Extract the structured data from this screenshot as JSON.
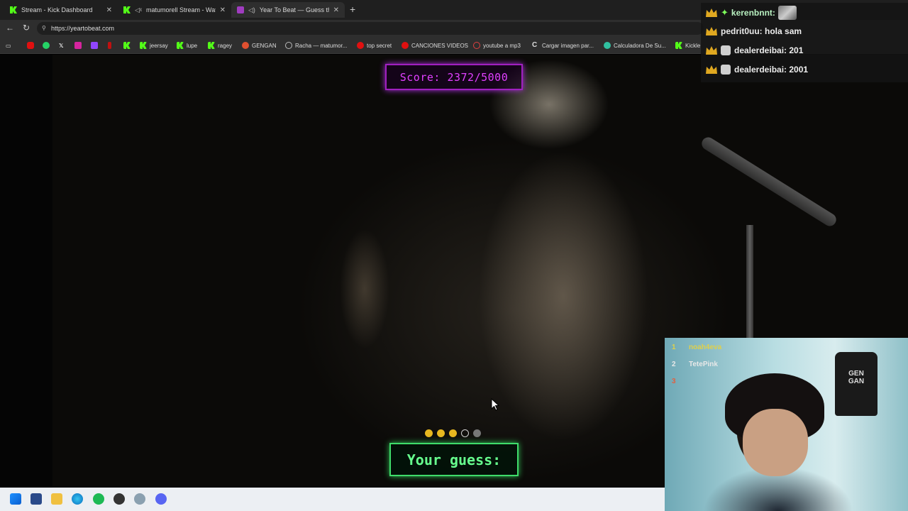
{
  "tabs": [
    {
      "label": "Stream - Kick Dashboard",
      "active": false
    },
    {
      "label": "matumorell Stream - Watch L",
      "active": false
    },
    {
      "label": "Year To Beat — Guess the Son",
      "active": true
    }
  ],
  "address": {
    "url": "https://yeartobeat.com"
  },
  "bookmarks": [
    {
      "label": "jeersay"
    },
    {
      "label": "lupe"
    },
    {
      "label": "ragey"
    },
    {
      "label": "GENGAN"
    },
    {
      "label": "Racha — matumor..."
    },
    {
      "label": "top secret"
    },
    {
      "label": "CANCIONES VIDEOS"
    },
    {
      "label": "youtube a mp3"
    },
    {
      "label": "Cargar imagen par..."
    },
    {
      "label": "Calculadora De Su..."
    },
    {
      "label": "Kickle"
    }
  ],
  "game": {
    "score_text": "Score: 2372/5000",
    "guess_label": "Your guess:",
    "rounds": [
      "filled",
      "filled",
      "filled",
      "current",
      "pending"
    ]
  },
  "chat": [
    {
      "user": "kerenbnnt:",
      "text": ""
    },
    {
      "user": "pedrit0uu:",
      "text": "hola sam"
    },
    {
      "user": "dealerdeibai:",
      "text": "201"
    },
    {
      "user": "dealerdeibai:",
      "text": "2001"
    }
  ],
  "webcam": {
    "leaderboard": [
      {
        "rank": "1",
        "name": "noah4eva",
        "color": "#e0d04a"
      },
      {
        "rank": "2",
        "name": "TetePink",
        "color": "#e8e8e8"
      },
      {
        "rank": "3",
        "name": "",
        "color": "#e06040"
      }
    ],
    "shirt_text": "GEN GAN"
  },
  "colors": {
    "score": "#e040ff",
    "guess": "#67ff8e",
    "kick": "#53fc18"
  }
}
